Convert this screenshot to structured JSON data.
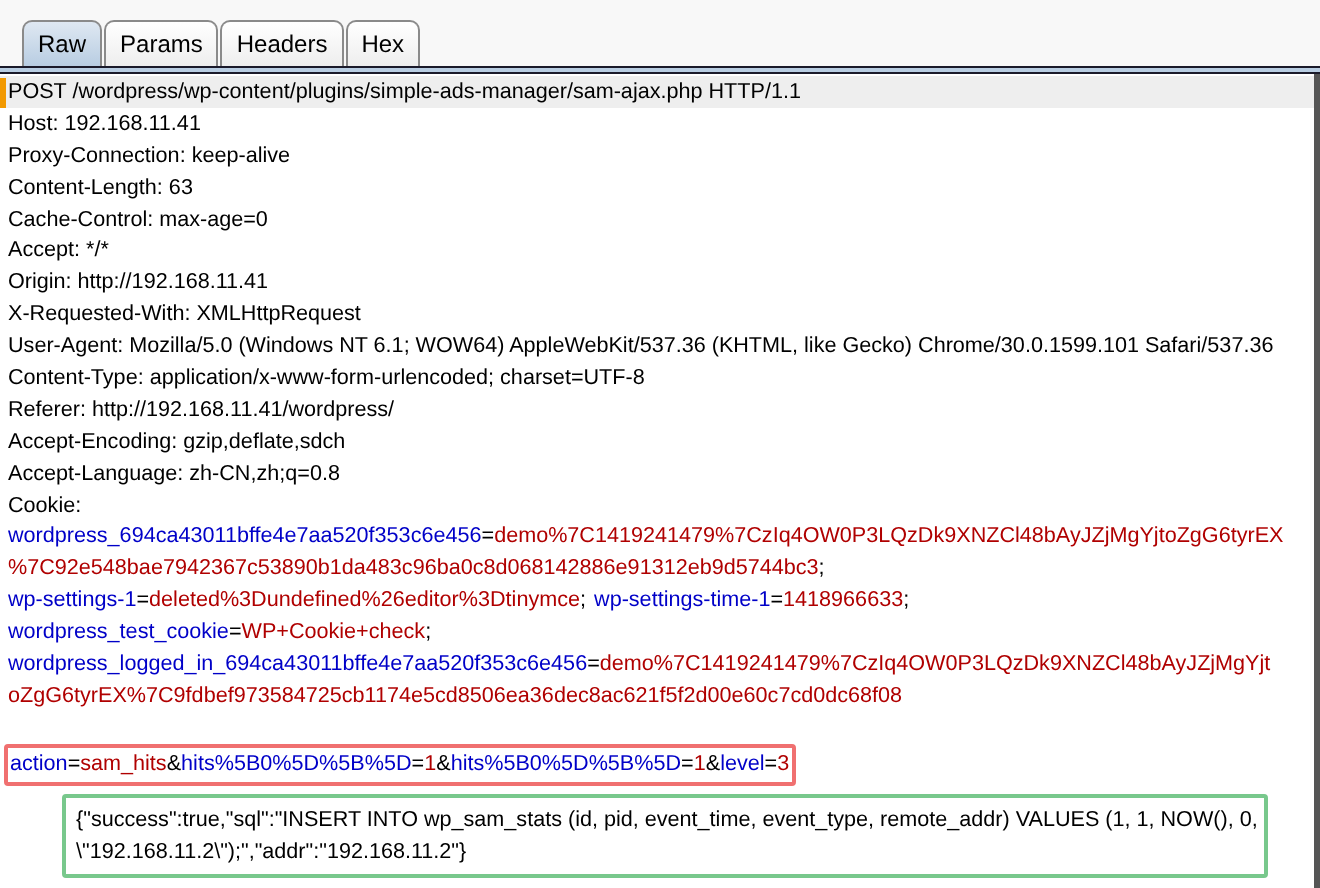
{
  "tabs": [
    {
      "label": "Raw",
      "selected": true
    },
    {
      "label": "Params",
      "selected": false
    },
    {
      "label": "Headers",
      "selected": false
    },
    {
      "label": "Hex",
      "selected": false
    }
  ],
  "request_line": "POST /wordpress/wp-content/plugins/simple-ads-manager/sam-ajax.php HTTP/1.1",
  "headers": [
    "Host: 192.168.11.41",
    "Proxy-Connection: keep-alive",
    "Content-Length: 63",
    "Cache-Control: max-age=0",
    "Accept: */*",
    "Origin: http://192.168.11.41",
    "X-Requested-With: XMLHttpRequest",
    "User-Agent: Mozilla/5.0 (Windows NT 6.1; WOW64) AppleWebKit/537.36 (KHTML, like Gecko) Chrome/30.0.1599.101 Safari/537.36",
    "Content-Type: application/x-www-form-urlencoded; charset=UTF-8",
    "Referer: http://192.168.11.41/wordpress/",
    "Accept-Encoding: gzip,deflate,sdch",
    "Accept-Language: zh-CN,zh;q=0.8",
    "Cookie:"
  ],
  "cookie_lines": [
    [
      {
        "kind": "name",
        "text": "wordpress_694ca43011bffe4e7aa520f353c6e456"
      },
      {
        "kind": "plain",
        "text": "="
      },
      {
        "kind": "value",
        "text": "demo%7C1419241479%7CzIq4OW0P3LQzDk9XNZCl48bAyJZjMgYjtoZgG6tyrEX"
      }
    ],
    [
      {
        "kind": "value",
        "text": "%7C92e548bae7942367c53890b1da483c96ba0c8d068142886e91312eb9d5744bc3"
      },
      {
        "kind": "plain",
        "text": ";"
      }
    ],
    [
      {
        "kind": "name",
        "text": "wp-settings-1"
      },
      {
        "kind": "plain",
        "text": "="
      },
      {
        "kind": "value",
        "text": "deleted%3Dundefined%26editor%3Dtinymce"
      },
      {
        "kind": "plain",
        "text": ";"
      },
      {
        "kind": "name",
        "text": "wp-settings-time-1"
      },
      {
        "kind": "plain",
        "text": "="
      },
      {
        "kind": "value",
        "text": "1418966633"
      },
      {
        "kind": "plain",
        "text": ";"
      }
    ],
    [
      {
        "kind": "name",
        "text": "wordpress_test_cookie"
      },
      {
        "kind": "plain",
        "text": "="
      },
      {
        "kind": "value",
        "text": "WP+Cookie+check"
      },
      {
        "kind": "plain",
        "text": ";"
      }
    ],
    [
      {
        "kind": "name",
        "text": "wordpress_logged_in_694ca43011bffe4e7aa520f353c6e456"
      },
      {
        "kind": "plain",
        "text": "="
      },
      {
        "kind": "value",
        "text": "demo%7C1419241479%7CzIq4OW0P3LQzDk9XNZCl48bAyJZjMgYjt"
      }
    ],
    [
      {
        "kind": "value",
        "text": "oZgG6tyrEX%7C9fdbef973584725cb1174e5cd8506ea36dec8ac621f5f2d00e60c7cd0dc68f08"
      }
    ]
  ],
  "body": [
    {
      "kind": "name",
      "text": "action"
    },
    {
      "kind": "plain",
      "text": "="
    },
    {
      "kind": "value",
      "text": "sam_hits"
    },
    {
      "kind": "plain",
      "text": "&"
    },
    {
      "kind": "name",
      "text": "hits%5B0%5D%5B%5D"
    },
    {
      "kind": "plain",
      "text": "="
    },
    {
      "kind": "value",
      "text": "1"
    },
    {
      "kind": "plain",
      "text": "&"
    },
    {
      "kind": "name",
      "text": "hits%5B0%5D%5B%5D"
    },
    {
      "kind": "plain",
      "text": "="
    },
    {
      "kind": "value",
      "text": "1"
    },
    {
      "kind": "plain",
      "text": "&"
    },
    {
      "kind": "name",
      "text": "level"
    },
    {
      "kind": "plain",
      "text": "="
    },
    {
      "kind": "value",
      "text": "3"
    }
  ],
  "response": [
    "{\"success\":true,\"sql\":\"INSERT INTO wp_sam_stats (id, pid, event_time, event_type, remote_addr) VALUES (1, 1, NOW(), 0,",
    "\\\"192.168.11.2\\\");\",\"addr\":\"192.168.11.2\"}"
  ]
}
